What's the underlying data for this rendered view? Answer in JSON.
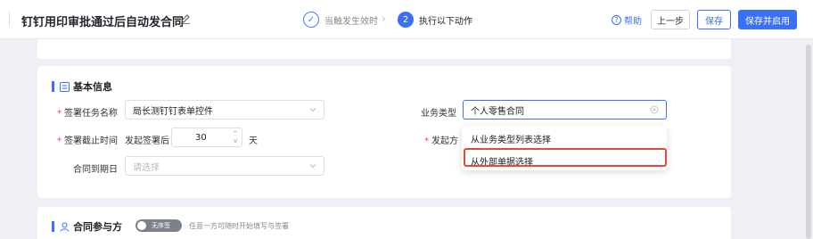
{
  "header": {
    "title": "钉钉用印审批通过后自动发合同",
    "steps": [
      {
        "num": "✓",
        "label": "当触发生效时"
      },
      {
        "num": "2",
        "label": "执行以下动作"
      }
    ],
    "separator": "›",
    "help": "帮助",
    "prev_label": "上一步",
    "save_label": "保存",
    "save_enable_label": "保存并启用"
  },
  "basic_info": {
    "title": "基本信息",
    "task_name_label": "签署任务名称",
    "task_name_value": "局长测钉钉表单控件",
    "deadline_label": "签署截止时间",
    "deadline_prefix": "发起签署后",
    "deadline_value": "30",
    "deadline_unit": "天",
    "expire_label": "合同到期日",
    "expire_placeholder": "请选择",
    "biz_type_label": "业务类型",
    "biz_type_value": "个人零售合同",
    "initiator_label": "发起方",
    "dropdown_options": [
      "从业务类型列表选择",
      "从外部单据选择"
    ]
  },
  "parties": {
    "title": "合同参与方",
    "toggle_label": "无序签",
    "hint": "任意一方可随时开始填写与签署"
  },
  "colors": {
    "accent": "#3a6ff7",
    "highlight": "#e04a3f",
    "required": "#f04a4a"
  }
}
